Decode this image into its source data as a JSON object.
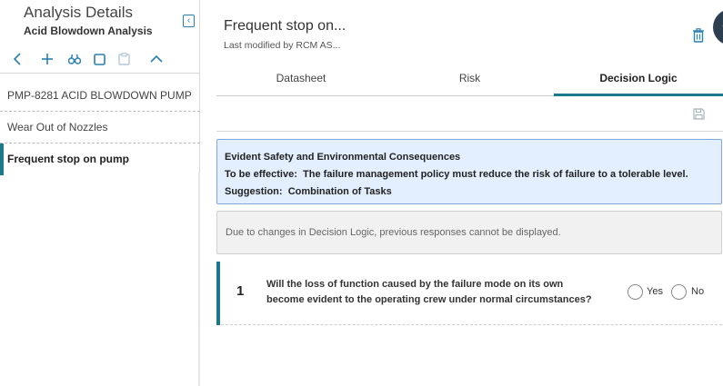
{
  "left_panel": {
    "title": "Analysis Details",
    "subtitle": "Acid Blowdown Analysis",
    "collapse_icon": "chevron-left-icon",
    "toolbar": [
      "back-icon",
      "add-icon",
      "binoculars-icon",
      "copy-icon",
      "paste-icon",
      "chevron-up-icon"
    ],
    "items": [
      {
        "label": "PMP-8281 ACID BLOWDOWN PUMP"
      },
      {
        "label": "Wear Out of Nozzles"
      },
      {
        "label": "Frequent stop on pump"
      }
    ]
  },
  "record": {
    "title": "Frequent stop on...",
    "subtitle": "Last modified by RCM AS..."
  },
  "tabs": [
    {
      "label": "Datasheet"
    },
    {
      "label": "Risk"
    },
    {
      "label": "Decision Logic"
    }
  ],
  "info": {
    "heading": "Evident Safety and Environmental Consequences",
    "effective_label": "To be effective:",
    "effective_text": "The failure management policy must reduce the risk of failure to a tolerable level.",
    "suggestion_label": "Suggestion:",
    "suggestion_text": "Combination of Tasks"
  },
  "notice": "Due to changes in Decision Logic, previous responses cannot be displayed.",
  "question": {
    "number": "1",
    "text": "Will the loss of function caused by the failure mode on its own become evident to the operating crew under normal circumstances?",
    "yes_label": "Yes",
    "no_label": "No"
  },
  "colors": {
    "accent": "#1a7a8c",
    "link_blue": "#2a7fb3",
    "info_bg": "#e3efff"
  }
}
